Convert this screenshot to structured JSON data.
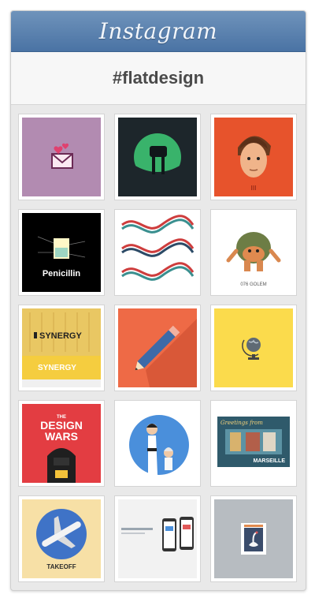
{
  "app": {
    "title": "Instagram"
  },
  "feed": {
    "hashtag": "#flatdesign"
  },
  "tiles": [
    {
      "row": 1,
      "col": 1,
      "subject": "love-letter envelope",
      "bg": "#b28bb1"
    },
    {
      "row": 1,
      "col": 2,
      "subject": "walker silhouette in green circle",
      "bg": "#1d262b"
    },
    {
      "row": 1,
      "col": 3,
      "subject": "anakin portrait",
      "bg": "#e7532c",
      "caption": "III"
    },
    {
      "row": 2,
      "col": 1,
      "subject": "penicillin infographic",
      "bg": "#000000",
      "caption": "Penicillin"
    },
    {
      "row": 2,
      "col": 2,
      "subject": "dna pattern",
      "bg": "#ffffff"
    },
    {
      "row": 2,
      "col": 3,
      "subject": "golem creature",
      "bg": "#ffffff",
      "caption": "076 GOLEM"
    },
    {
      "row": 3,
      "col": 1,
      "subject": "synergy brand board",
      "bg": "#f5cd3f",
      "caption": "SYNERGY",
      "caption2": "SYNERGY"
    },
    {
      "row": 3,
      "col": 2,
      "subject": "pencil with long shadow",
      "bg": "#ee6a46"
    },
    {
      "row": 3,
      "col": 3,
      "subject": "globe icon",
      "bg": "#fbdb4c"
    },
    {
      "row": 4,
      "col": 1,
      "subject": "design wars poster",
      "bg": "#e33d42",
      "caption": "THE",
      "caption2": "DESIGN",
      "caption3": "WARS"
    },
    {
      "row": 4,
      "col": 2,
      "subject": "karate characters in blue circle",
      "bg": "#ffffff"
    },
    {
      "row": 4,
      "col": 3,
      "subject": "marseille postcard",
      "bg": "#ffffff",
      "caption": "Greetings from",
      "caption2": "MARSEILLE"
    },
    {
      "row": 5,
      "col": 1,
      "subject": "airplane takeoff",
      "bg": "#f7e0a6",
      "caption": "TAKEOFF"
    },
    {
      "row": 5,
      "col": 2,
      "subject": "mobile app screens",
      "bg": "#f2f2f2"
    },
    {
      "row": 5,
      "col": 3,
      "subject": "swan postage stamp",
      "bg": "#b7bcc1"
    }
  ]
}
